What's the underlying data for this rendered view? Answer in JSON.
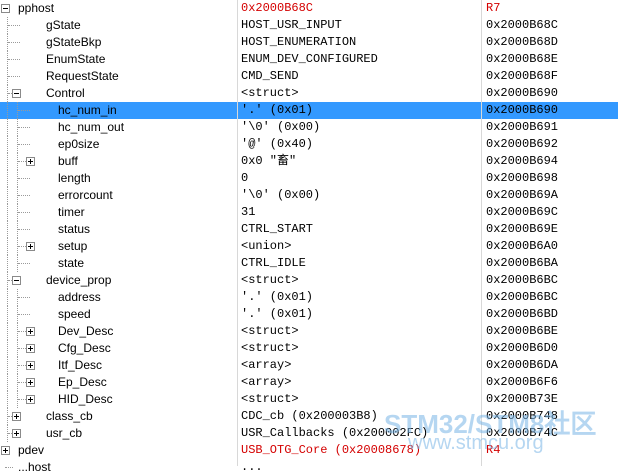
{
  "rows": [
    {
      "name": "pphost",
      "value": "0x2000B68C",
      "location": "R7",
      "depth": 0,
      "expander": "minus",
      "red": true
    },
    {
      "name": "gState",
      "value": "HOST_USR_INPUT",
      "location": "0x2000B68C",
      "depth": 1,
      "expander": "none"
    },
    {
      "name": "gStateBkp",
      "value": "HOST_ENUMERATION",
      "location": "0x2000B68D",
      "depth": 1,
      "expander": "none"
    },
    {
      "name": "EnumState",
      "value": "ENUM_DEV_CONFIGURED",
      "location": "0x2000B68E",
      "depth": 1,
      "expander": "none"
    },
    {
      "name": "RequestState",
      "value": "CMD_SEND",
      "location": "0x2000B68F",
      "depth": 1,
      "expander": "none"
    },
    {
      "name": "Control",
      "value": "<struct>",
      "location": "0x2000B690",
      "depth": 1,
      "expander": "minus"
    },
    {
      "name": "hc_num_in",
      "value": "'.' (0x01)",
      "location": "0x2000B690",
      "depth": 2,
      "expander": "none",
      "selected": true
    },
    {
      "name": "hc_num_out",
      "value": "'\\0' (0x00)",
      "location": "0x2000B691",
      "depth": 2,
      "expander": "none"
    },
    {
      "name": "ep0size",
      "value": "'@' (0x40)",
      "location": "0x2000B692",
      "depth": 2,
      "expander": "none"
    },
    {
      "name": "buff",
      "value": "0x0 \"畜\"",
      "location": "0x2000B694",
      "depth": 2,
      "expander": "plus"
    },
    {
      "name": "length",
      "value": "0",
      "location": "0x2000B698",
      "depth": 2,
      "expander": "none"
    },
    {
      "name": "errorcount",
      "value": "'\\0' (0x00)",
      "location": "0x2000B69A",
      "depth": 2,
      "expander": "none"
    },
    {
      "name": "timer",
      "value": "31",
      "location": "0x2000B69C",
      "depth": 2,
      "expander": "none"
    },
    {
      "name": "status",
      "value": "CTRL_START",
      "location": "0x2000B69E",
      "depth": 2,
      "expander": "none"
    },
    {
      "name": "setup",
      "value": "<union>",
      "location": "0x2000B6A0",
      "depth": 2,
      "expander": "plus"
    },
    {
      "name": "state",
      "value": "CTRL_IDLE",
      "location": "0x2000B6BA",
      "depth": 2,
      "expander": "none"
    },
    {
      "name": "device_prop",
      "value": "<struct>",
      "location": "0x2000B6BC",
      "depth": 1,
      "expander": "minus"
    },
    {
      "name": "address",
      "value": "'.' (0x01)",
      "location": "0x2000B6BC",
      "depth": 2,
      "expander": "none"
    },
    {
      "name": "speed",
      "value": "'.' (0x01)",
      "location": "0x2000B6BD",
      "depth": 2,
      "expander": "none"
    },
    {
      "name": "Dev_Desc",
      "value": "<struct>",
      "location": "0x2000B6BE",
      "depth": 2,
      "expander": "plus"
    },
    {
      "name": "Cfg_Desc",
      "value": "<struct>",
      "location": "0x2000B6D0",
      "depth": 2,
      "expander": "plus"
    },
    {
      "name": "Itf_Desc",
      "value": "<array>",
      "location": "0x2000B6DA",
      "depth": 2,
      "expander": "plus"
    },
    {
      "name": "Ep_Desc",
      "value": "<array>",
      "location": "0x2000B6F6",
      "depth": 2,
      "expander": "plus"
    },
    {
      "name": "HID_Desc",
      "value": "<struct>",
      "location": "0x2000B73E",
      "depth": 2,
      "expander": "plus"
    },
    {
      "name": "class_cb",
      "value": "CDC_cb (0x200003B8)",
      "location": "0x2000B748",
      "depth": 1,
      "expander": "plus"
    },
    {
      "name": "usr_cb",
      "value": "USR_Callbacks (0x200002FC)",
      "location": "0x2000B74C",
      "depth": 1,
      "expander": "plus"
    },
    {
      "name": "pdev",
      "value": "USB_OTG_Core (0x20008678)",
      "location": "R4",
      "depth": 0,
      "expander": "plus",
      "red_value": true,
      "red_location": true
    },
    {
      "name": "...host",
      "value": "...",
      "location": "",
      "depth": 0,
      "expander": "none"
    }
  ],
  "watermark": {
    "line1": "STM32/STM8社区",
    "line2": "www.stmcu.org"
  },
  "colors": {
    "selection": "#3399ff",
    "highlight_text": "#d40000"
  }
}
